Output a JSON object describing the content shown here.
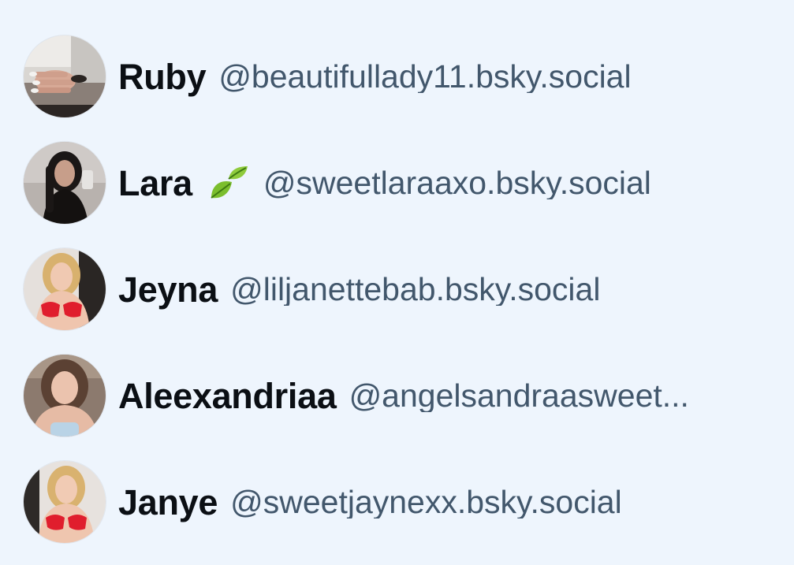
{
  "accounts": [
    {
      "name": "Ruby",
      "handle": "@beautifullady11.bsky.social",
      "avatar_icon": "avatar-hands-photo",
      "has_emoji": false
    },
    {
      "name": "Lara",
      "emoji_icon": "leaf-fluttering-icon",
      "handle": "@sweetlaraaxo.bsky.social",
      "avatar_icon": "avatar-selfie-dark-photo",
      "has_emoji": true
    },
    {
      "name": "Jeyna",
      "handle": "@liljanettebab.bsky.social",
      "avatar_icon": "avatar-red-top-photo",
      "has_emoji": false
    },
    {
      "name": "Aleexandriaa",
      "handle": "@angelsandraasweet...",
      "avatar_icon": "avatar-portrait-photo",
      "has_emoji": false
    },
    {
      "name": "Janye",
      "handle": "@sweetjaynexx.bsky.social",
      "avatar_icon": "avatar-red-top-photo",
      "has_emoji": false
    }
  ],
  "colors": {
    "background": "#EEF5FD",
    "name_text": "#0B0F14",
    "handle_text": "#42576C"
  }
}
